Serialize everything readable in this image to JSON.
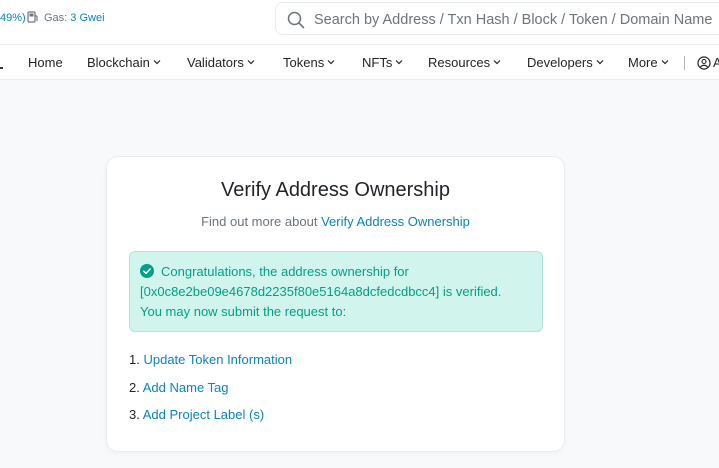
{
  "topbar": {
    "price_change": "49%)",
    "gas_label": "Gas:",
    "gas_value": "3 Gwei",
    "search_placeholder": "Search by Address / Txn Hash / Block / Token / Domain Name"
  },
  "nav": {
    "items": [
      {
        "label": "Home"
      },
      {
        "label": "Blockchain"
      },
      {
        "label": "Validators"
      },
      {
        "label": "Tokens"
      },
      {
        "label": "NFTs"
      },
      {
        "label": "Resources"
      },
      {
        "label": "Developers"
      },
      {
        "label": "More"
      }
    ],
    "user_label": "A"
  },
  "card": {
    "title": "Verify Address Ownership",
    "subtitle_prefix": "Find out more about",
    "subtitle_link": "Verify Address Ownership",
    "alert": {
      "line1": "Congratulations, the address ownership for",
      "line2": "[0x0c8e2be09e4678d2235f80e5164a8dcfedcdbcc4] is verified.",
      "line3": "You may now submit the request to:"
    },
    "steps": [
      {
        "num": "1.",
        "label": "Update Token Information"
      },
      {
        "num": "2.",
        "label": "Add Name Tag"
      },
      {
        "num": "3.",
        "label": "Add Project Label (s)"
      }
    ]
  }
}
